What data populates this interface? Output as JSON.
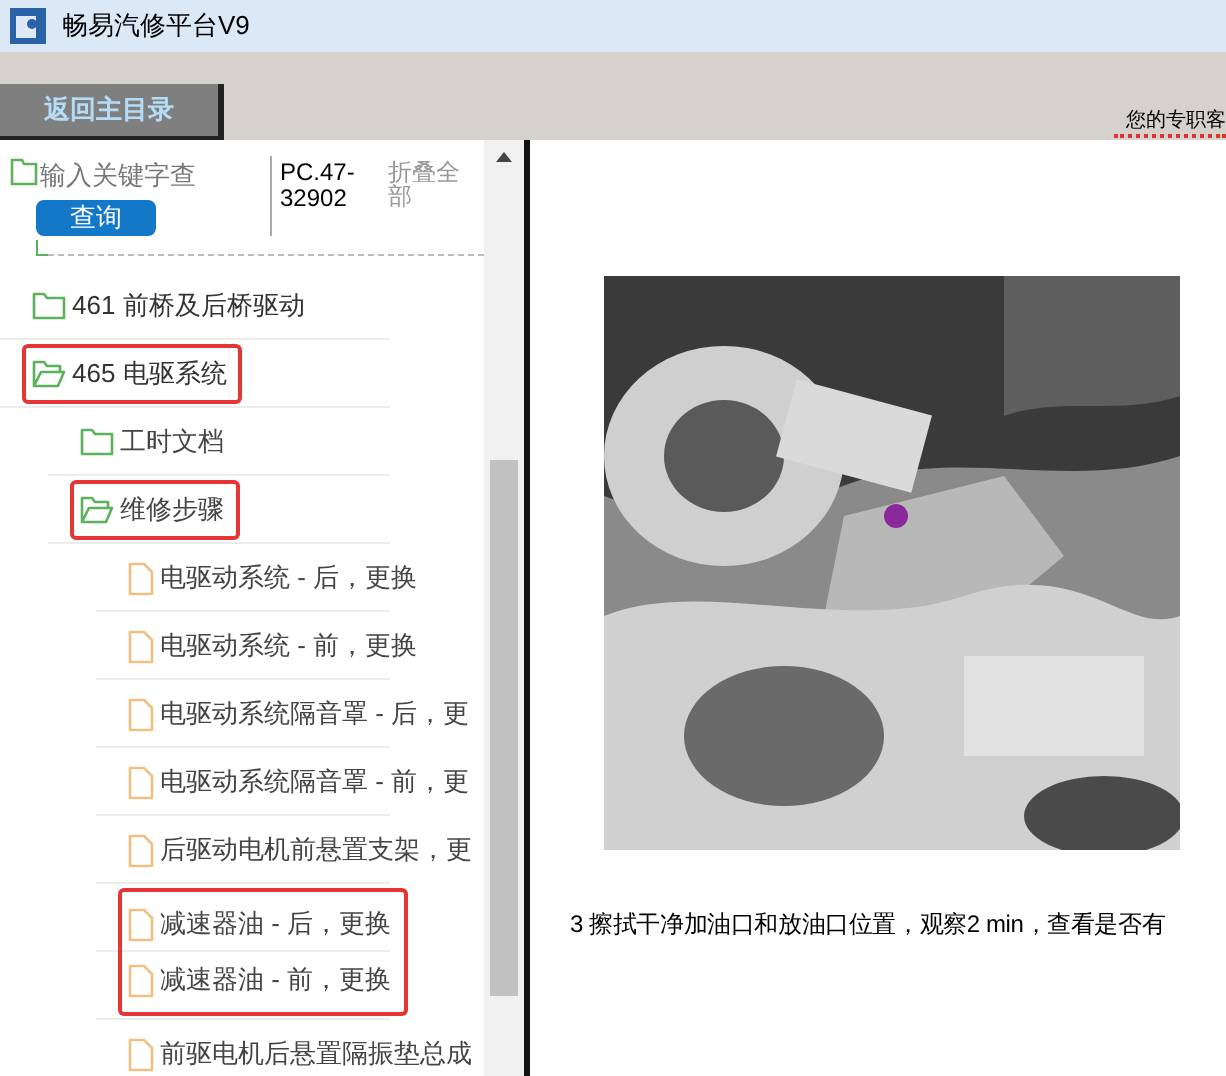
{
  "window": {
    "title": "畅易汽修平台V9"
  },
  "toolbar": {
    "back_button": "返回主目录",
    "service_text": "您的专职客"
  },
  "search": {
    "placeholder": "输入关键字查",
    "button": "查询",
    "code": "PC.47-32902",
    "collapse_all": "折叠全部"
  },
  "tree": [
    {
      "label": "461 前桥及后桥驱动",
      "kind": "folder",
      "expanded": false,
      "highlighted": false
    },
    {
      "label": "465 电驱系统",
      "kind": "folder",
      "expanded": true,
      "highlighted": true,
      "children": [
        {
          "label": "工时文档",
          "kind": "folder",
          "expanded": false,
          "highlighted": false
        },
        {
          "label": "维修步骤",
          "kind": "folder",
          "expanded": true,
          "highlighted": true,
          "children": [
            {
              "label": "电驱动系统 - 后，更换",
              "kind": "file",
              "highlighted": false
            },
            {
              "label": "电驱动系统 - 前，更换",
              "kind": "file",
              "highlighted": false
            },
            {
              "label": "电驱动系统隔音罩 - 后，更",
              "kind": "file",
              "highlighted": false
            },
            {
              "label": "电驱动系统隔音罩 - 前，更",
              "kind": "file",
              "highlighted": false
            },
            {
              "label": "后驱动电机前悬置支架，更",
              "kind": "file",
              "highlighted": false
            },
            {
              "label": "减速器油 - 后，更换",
              "kind": "file",
              "highlighted": true
            },
            {
              "label": "减速器油 - 前，更换",
              "kind": "file",
              "highlighted": true
            },
            {
              "label": "前驱电机后悬置隔振垫总成",
              "kind": "file",
              "highlighted": false
            }
          ]
        }
      ]
    }
  ],
  "document": {
    "step_text": "3  擦拭干净加油口和放油口位置，观察2 min，查看是否有"
  }
}
